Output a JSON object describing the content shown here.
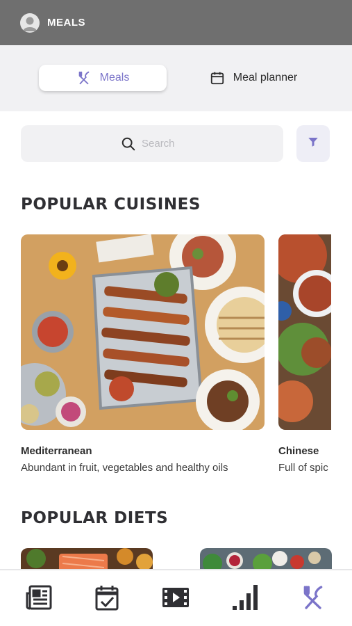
{
  "app": {
    "title": "MEALS"
  },
  "segment": {
    "active_label": "Meals",
    "inactive_label": "Meal planner"
  },
  "search": {
    "placeholder": "Search"
  },
  "sections": {
    "cuisines_title": "POPULAR CUISINES",
    "diets_title": "POPULAR DIETS"
  },
  "cuisines": [
    {
      "name": "Mediterranean",
      "description": "Abundant in fruit, vegetables and healthy oils"
    },
    {
      "name": "Chinese",
      "description": "Full of spic"
    }
  ],
  "tabs": [
    {
      "icon": "newspaper-icon"
    },
    {
      "icon": "calendar-check-icon"
    },
    {
      "icon": "video-icon"
    },
    {
      "icon": "bar-chart-icon"
    },
    {
      "icon": "fork-knife-icon",
      "active": true
    }
  ],
  "colors": {
    "accent": "#7b74c9",
    "topbar": "#6f6f6f",
    "icon_dark": "#2f2f33"
  }
}
